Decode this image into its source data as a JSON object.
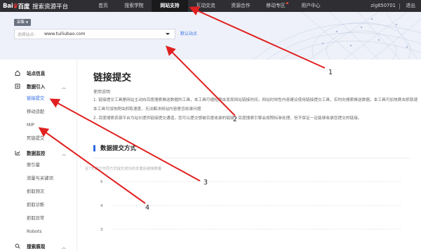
{
  "topbar": {
    "logo_left": "Bai",
    "logo_right": "百度",
    "brand": "搜索资源平台",
    "nav": [
      {
        "label": "首页",
        "active": false,
        "dot": false
      },
      {
        "label": "搜索学院",
        "active": false,
        "dot": false
      },
      {
        "label": "网站支持",
        "active": true,
        "dot": false
      },
      {
        "label": "互动交流",
        "active": false,
        "dot": false
      },
      {
        "label": "资源合作",
        "active": false,
        "dot": false
      },
      {
        "label": "移动专区",
        "active": false,
        "dot": true
      },
      {
        "label": "用户中心",
        "active": false,
        "dot": false
      }
    ],
    "user": "zlg850701",
    "logout": "退出"
  },
  "site_selector": {
    "tag": "采集",
    "label": "选择站点:",
    "value": "www.tuiliubao.com",
    "default_link": "默认站点"
  },
  "sidebar": {
    "groups": [
      {
        "label": "站点信息",
        "icon": "home-icon",
        "chevron": ""
      },
      {
        "label": "数据引入",
        "icon": "data-import-icon",
        "chevron": "^"
      },
      {
        "label": "数据监控",
        "icon": "data-monitor-icon",
        "chevron": "^"
      },
      {
        "label": "搜索展现",
        "icon": "search-display-icon",
        "chevron": "^"
      }
    ],
    "import_items": [
      "链接提交",
      "移动适配",
      "MIP",
      "死链提交"
    ],
    "monitor_items": [
      "索引量",
      "流量与关键词",
      "抓取频次",
      "抓取诊断",
      "抓取异常",
      "Robots"
    ],
    "active_item": "链接提交"
  },
  "main": {
    "title": "链接提交",
    "intro_heading": "使用说明",
    "intro_lines": [
      "1. 链接提交工具是网站主动向百度搜索推送数据的工具，本工具可缩短爬虫发现网站链接时间，网站时效性内容建议使用链接提交工具，实时向搜索推送数据。本工具可加快爬虫抓取速度，无法解决网站内容是否收录问题",
      "本工具可加快爬虫抓取速度，无法解决网站内容是否收录问题",
      "2. 百度搜索资源平台为站长提供链接提交通道，您可以提交想被百度收录的链接，百度搜索引擎会按照标准处理，但不保证一定能够收录您提交的链接。"
    ],
    "section_title": "数据提交方式",
    "chart_caption": "近7天通过不同方式提交成功的去重后链接数量"
  },
  "chart_data": {
    "type": "line",
    "title": "",
    "xlabel": "",
    "ylabel": "",
    "y_ticks": [
      "5",
      "4",
      "3"
    ],
    "ylim": [
      3,
      5
    ],
    "series": [],
    "grid": true
  },
  "annotations": {
    "color": "#e02020",
    "labels": [
      "1",
      "2",
      "3",
      "4"
    ]
  }
}
